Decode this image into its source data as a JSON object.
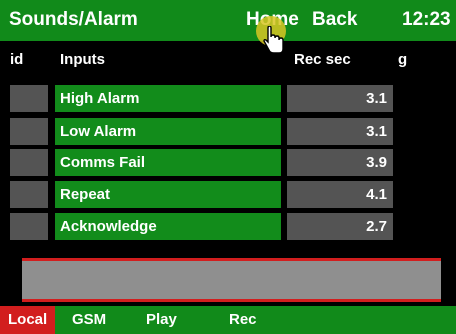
{
  "header": {
    "title": "Sounds/Alarm",
    "home_label": "Home",
    "back_label": "Back",
    "clock": "12:23"
  },
  "columns": {
    "id": "id",
    "inputs": "Inputs",
    "rec_sec": "Rec sec",
    "g": "g"
  },
  "rows": [
    {
      "id": "",
      "name": "High Alarm",
      "rec_sec": "3.1"
    },
    {
      "id": "",
      "name": "Low Alarm",
      "rec_sec": "3.1"
    },
    {
      "id": "",
      "name": "Comms Fail",
      "rec_sec": "3.9"
    },
    {
      "id": "",
      "name": "Repeat",
      "rec_sec": "4.1"
    },
    {
      "id": "",
      "name": "Acknowledge",
      "rec_sec": "2.7"
    }
  ],
  "message_box": {
    "text": ""
  },
  "footer": {
    "tabs": [
      {
        "label": "Local",
        "active": true
      },
      {
        "label": "GSM",
        "active": false
      },
      {
        "label": "Play",
        "active": false
      },
      {
        "label": "Rec",
        "active": false
      }
    ]
  },
  "colors": {
    "bar_green": "#118a1a",
    "cell_green": "#128c1b",
    "cell_gray": "#545454",
    "active_red": "#d21e1e",
    "message_gray": "#8f8f8f",
    "background": "#000000"
  },
  "icons": {
    "cursor": "hand-pointer-icon"
  }
}
